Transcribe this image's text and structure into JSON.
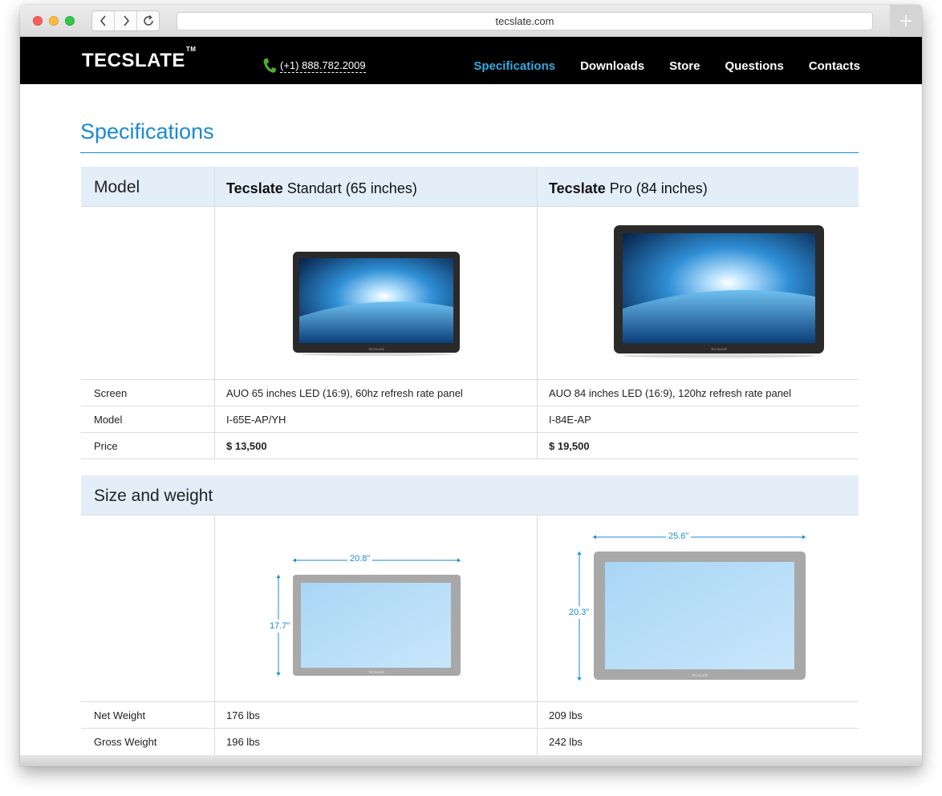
{
  "browser": {
    "url": "tecslate.com"
  },
  "site": {
    "logo": "TECSLATE",
    "logo_tm": "TM",
    "phone": "(+1) 888.782.2009",
    "nav": [
      "Specifications",
      "Downloads",
      "Store",
      "Questions",
      "Contacts"
    ],
    "active_nav": "Specifications"
  },
  "page": {
    "title": "Specifications"
  },
  "model_table": {
    "header_label": "Model",
    "columns": [
      {
        "brand": "Tecslate",
        "name": "Standart (65 inches)"
      },
      {
        "brand": "Tecslate",
        "name": "Pro (84 inches)"
      }
    ],
    "rows": [
      {
        "label": "Screen",
        "values": [
          "AUO 65 inches LED (16:9), 60hz refresh rate panel",
          "AUO 84 inches LED (16:9), 120hz refresh rate panel"
        ]
      },
      {
        "label": "Model",
        "values": [
          "I-65E-AP/YH",
          "I-84E-AP"
        ]
      },
      {
        "label": "Price",
        "values": [
          "$ 13,500",
          "$ 19,500"
        ]
      }
    ],
    "screen_brand_label": "TECSLATE"
  },
  "size_table": {
    "header_label": "Size and weight",
    "dimensions": [
      {
        "width": "20.8\"",
        "height": "17.7\""
      },
      {
        "width": "25.6\"",
        "height": "20.3\""
      }
    ],
    "rows": [
      {
        "label": "Net Weight",
        "values": [
          "176 lbs",
          "209 lbs"
        ]
      },
      {
        "label": "Gross Weight",
        "values": [
          "196 lbs",
          "242 lbs"
        ]
      }
    ]
  },
  "colors": {
    "accent": "#1a8ad4",
    "nav_active": "#36a9e1",
    "header_bg": "#000000",
    "band_bg": "#e3eef9",
    "dimension_line": "#1a8ad4"
  }
}
